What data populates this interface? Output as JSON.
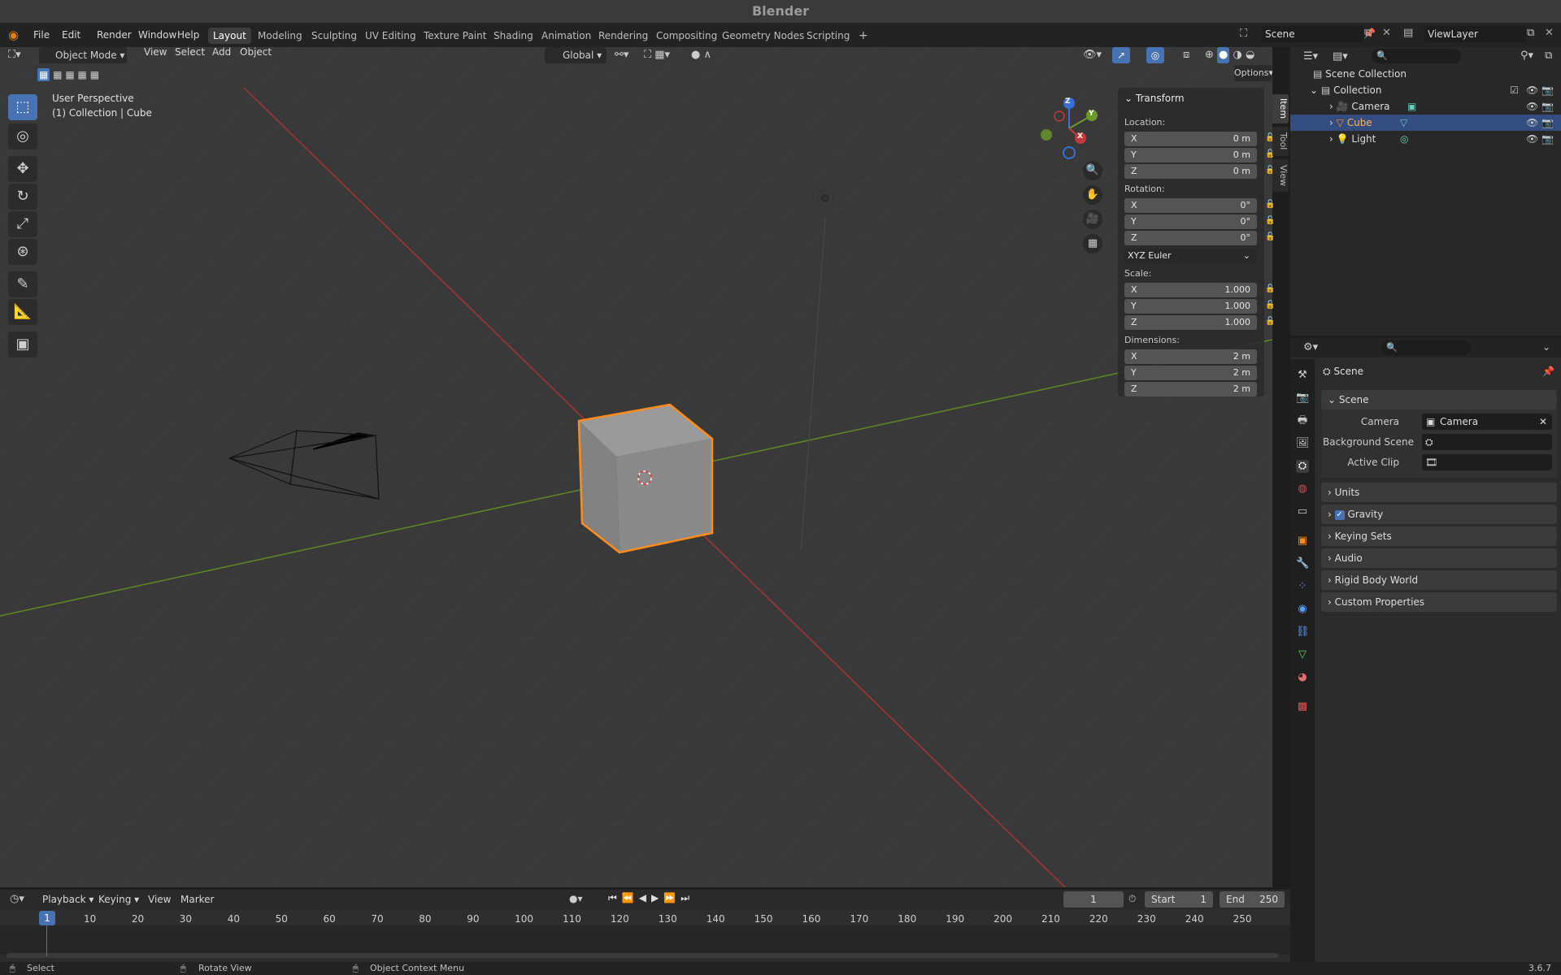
{
  "app": {
    "title": "Blender",
    "version": "3.6.7"
  },
  "menus": [
    "File",
    "Edit",
    "Render",
    "Window",
    "Help"
  ],
  "workspaces": [
    "Layout",
    "Modeling",
    "Sculpting",
    "UV Editing",
    "Texture Paint",
    "Shading",
    "Animation",
    "Rendering",
    "Compositing",
    "Geometry Nodes",
    "Scripting"
  ],
  "scene_field": "Scene",
  "viewlayer_field": "ViewLayer",
  "viewport_header": {
    "mode": "Object Mode",
    "menus": [
      "View",
      "Select",
      "Add",
      "Object"
    ],
    "orientation": "Global",
    "options_label": "Options"
  },
  "viewport": {
    "perspective": "User Perspective",
    "context": "(1) Collection | Cube"
  },
  "gizmo": {
    "z": "Z",
    "y": "Y",
    "x": "X"
  },
  "npanel": {
    "title": "Transform",
    "location_label": "Location:",
    "location": [
      {
        "axis": "X",
        "value": "0 m"
      },
      {
        "axis": "Y",
        "value": "0 m"
      },
      {
        "axis": "Z",
        "value": "0 m"
      }
    ],
    "rotation_label": "Rotation:",
    "rotation": [
      {
        "axis": "X",
        "value": "0°"
      },
      {
        "axis": "Y",
        "value": "0°"
      },
      {
        "axis": "Z",
        "value": "0°"
      }
    ],
    "rotation_mode": "XYZ Euler",
    "scale_label": "Scale:",
    "scale": [
      {
        "axis": "X",
        "value": "1.000"
      },
      {
        "axis": "Y",
        "value": "1.000"
      },
      {
        "axis": "Z",
        "value": "1.000"
      }
    ],
    "dimensions_label": "Dimensions:",
    "dimensions": [
      {
        "axis": "X",
        "value": "2 m"
      },
      {
        "axis": "Y",
        "value": "2 m"
      },
      {
        "axis": "Z",
        "value": "2 m"
      }
    ],
    "tabs": [
      "Item",
      "Tool",
      "View"
    ]
  },
  "outliner": {
    "rows": [
      {
        "label": "Scene Collection"
      },
      {
        "label": "Collection"
      },
      {
        "label": "Camera"
      },
      {
        "label": "Cube"
      },
      {
        "label": "Light"
      }
    ]
  },
  "properties": {
    "header": "Scene",
    "panel_title": "Scene",
    "camera_label": "Camera",
    "camera_value": "Camera",
    "background_label": "Background Scene",
    "clip_label": "Active Clip",
    "sections": [
      "Units",
      "Gravity",
      "Keying Sets",
      "Audio",
      "Rigid Body World",
      "Custom Properties"
    ]
  },
  "timeline": {
    "menus": [
      "Playback",
      "Keying",
      "View",
      "Marker"
    ],
    "current_frame": "1",
    "start_label": "Start",
    "start": "1",
    "end_label": "End",
    "end": "250",
    "ticks": [
      "1",
      "10",
      "20",
      "30",
      "40",
      "50",
      "60",
      "70",
      "80",
      "90",
      "100",
      "110",
      "120",
      "130",
      "140",
      "150",
      "160",
      "170",
      "180",
      "190",
      "200",
      "210",
      "220",
      "230",
      "240",
      "250"
    ]
  },
  "status": {
    "select": "Select",
    "rotate": "Rotate View",
    "context": "Object Context Menu"
  },
  "colors": {
    "accent": "#4772b3",
    "selection": "#ff8c1a",
    "x_axis": "#c43a3a",
    "y_axis": "#6a9a2a",
    "z_axis": "#3a6fd8"
  }
}
